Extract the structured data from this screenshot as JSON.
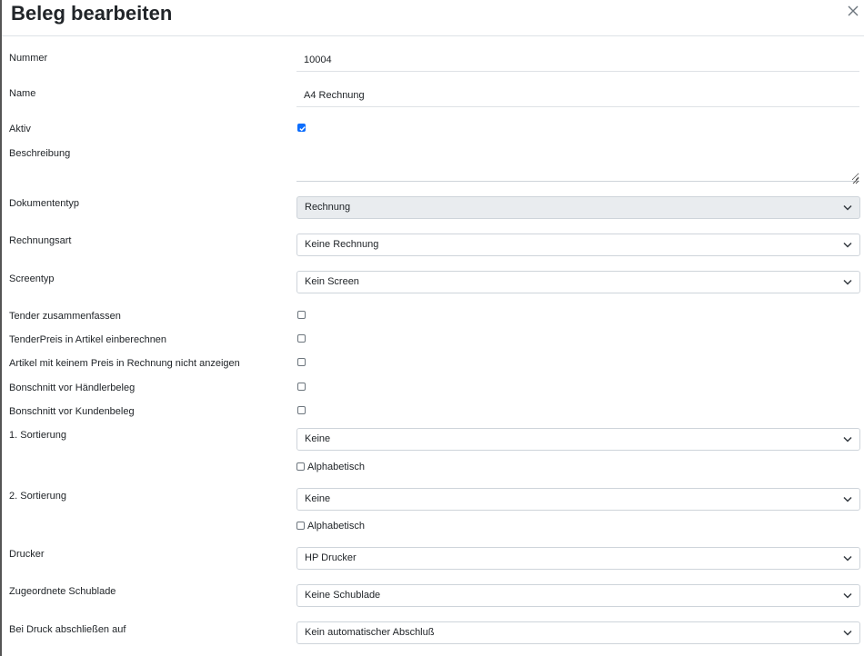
{
  "header": {
    "title": "Beleg bearbeiten",
    "close_icon": "close-icon"
  },
  "form": {
    "nummer": {
      "label": "Nummer",
      "value": "10004"
    },
    "name": {
      "label": "Name",
      "value": "A4 Rechnung"
    },
    "aktiv": {
      "label": "Aktiv",
      "checked": true
    },
    "beschreibung": {
      "label": "Beschreibung",
      "value": ""
    },
    "dokumententyp": {
      "label": "Dokumententyp",
      "value": "Rechnung",
      "disabled": true
    },
    "rechnungsart": {
      "label": "Rechnungsart",
      "value": "Keine Rechnung"
    },
    "screentyp": {
      "label": "Screentyp",
      "value": "Kein Screen"
    },
    "tender_zusammenfassen": {
      "label": "Tender zusammenfassen",
      "checked": false
    },
    "tenderpreis": {
      "label": "TenderPreis in Artikel einberechnen",
      "checked": false
    },
    "artikel_kein_preis": {
      "label": "Artikel mit keinem Preis in Rechnung nicht anzeigen",
      "checked": false
    },
    "bonschnitt_haendler": {
      "label": "Bonschnitt vor Händlerbeleg",
      "checked": false
    },
    "bonschnitt_kunden": {
      "label": "Bonschnitt vor Kundenbeleg",
      "checked": false
    },
    "sortierung1": {
      "label": "1. Sortierung",
      "value": "Keine",
      "alphabetisch_label": "Alphabetisch",
      "alphabetisch": false
    },
    "sortierung2": {
      "label": "2. Sortierung",
      "value": "Keine",
      "alphabetisch_label": "Alphabetisch",
      "alphabetisch": false
    },
    "drucker": {
      "label": "Drucker",
      "value": "HP Drucker"
    },
    "schublade": {
      "label": "Zugeordnete Schublade",
      "value": "Keine Schublade"
    },
    "abschluss": {
      "label": "Bei Druck abschließen auf",
      "value": "Kein automatischer Abschluß"
    }
  },
  "colors": {
    "accent": "#0d6efd",
    "border": "#ced4da",
    "disabled_bg": "#e9ecef"
  }
}
